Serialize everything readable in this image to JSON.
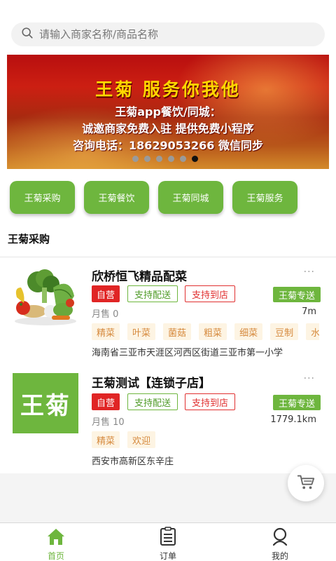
{
  "search": {
    "placeholder": "请输入商家名称/商品名称"
  },
  "banner": {
    "title": "王菊   服务你我他",
    "line1": "王菊app餐饮/同城：",
    "line2": "诚邀商家免费入驻   提供免费小程序",
    "line3": "咨询电话：18629053266  微信同步",
    "slide_count": 6,
    "active_slide": 6
  },
  "categories": [
    "王菊采购",
    "王菊餐饮",
    "王菊同城",
    "王菊服务"
  ],
  "section": {
    "title": "王菊采购"
  },
  "stores": [
    {
      "name": "欣桥恒飞精品配菜",
      "thumbnail": "vegetables-photo",
      "more": "···",
      "badge_self": "自营",
      "badge_ship": "支持配送",
      "badge_shop": "支持到店",
      "express": "王菊专送",
      "sales": "月售 0",
      "distance": "7m",
      "tags": [
        "精菜",
        "叶菜",
        "菌菇",
        "粗菜",
        "细菜",
        "豆制",
        "水"
      ],
      "address": "海南省三亚市天涯区河西区街道三亚市第一小学"
    },
    {
      "name": "王菊测试【连锁子店】",
      "thumbnail_text": "王菊",
      "more": "···",
      "badge_self": "自营",
      "badge_ship": "支持配送",
      "badge_shop": "支持到店",
      "express": "王菊专送",
      "sales": "月售 10",
      "distance": "1779.1km",
      "tags": [
        "精菜",
        "欢迎"
      ],
      "address": "西安市高新区东辛庄"
    }
  ],
  "tabbar": {
    "items": [
      {
        "label": "首页",
        "icon": "home-icon",
        "active": true
      },
      {
        "label": "订单",
        "icon": "order-list-icon",
        "active": false
      },
      {
        "label": "我的",
        "icon": "user-icon",
        "active": false
      }
    ]
  },
  "colors": {
    "accent": "#6eb63e",
    "red": "#e02525",
    "tag_bg": "#fdf4e3",
    "tag_text": "#d68a3e"
  }
}
